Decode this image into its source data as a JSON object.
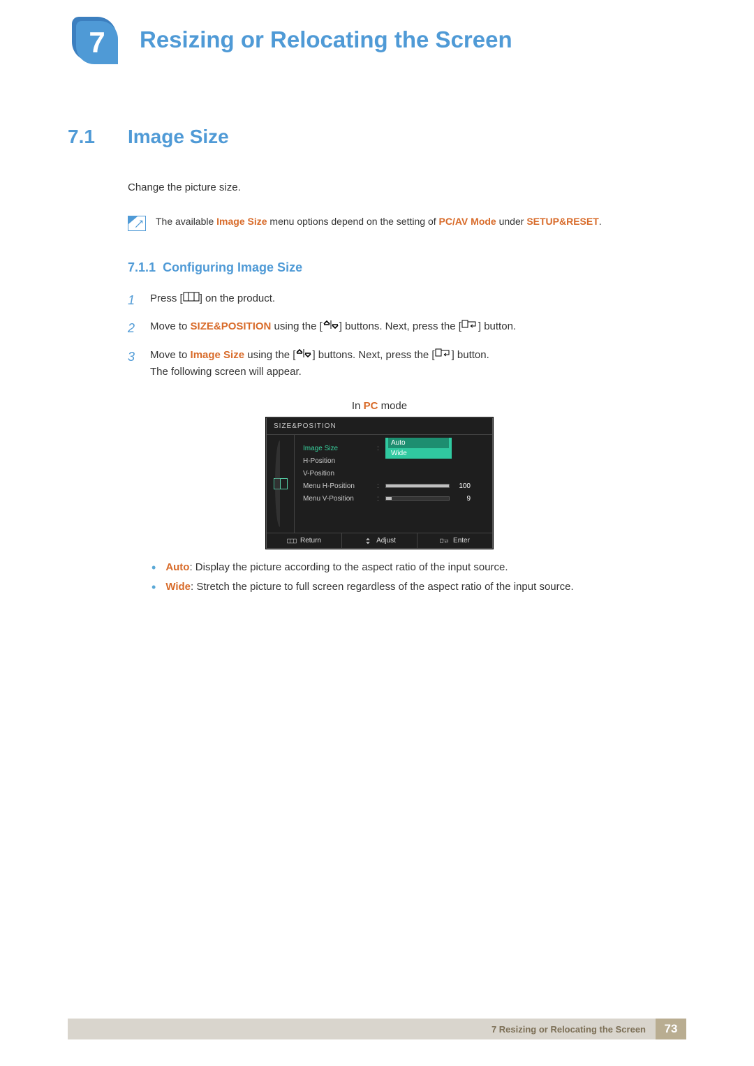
{
  "chapter": {
    "number": "7",
    "title": "Resizing or Relocating the Screen"
  },
  "section": {
    "number": "7.1",
    "title": "Image Size"
  },
  "intro": "Change the picture size.",
  "note": {
    "pre": "The available ",
    "hl1": "Image Size",
    "mid": " menu options depend on the setting of ",
    "hl2": "PC/AV Mode",
    "mid2": " under ",
    "hl3": "SETUP&RESET",
    "post": "."
  },
  "subsection": {
    "number": "7.1.1",
    "title": "Configuring Image Size"
  },
  "steps": [
    {
      "n": "1",
      "pre": "Press [",
      "post": "] on the product."
    },
    {
      "n": "2",
      "pre": "Move to ",
      "hl": "SIZE&POSITION",
      "mid1": " using the [",
      "mid2": "] buttons. Next, press the [",
      "post": "] button."
    },
    {
      "n": "3",
      "pre": "Move to ",
      "hl": "Image Size",
      "mid1": " using the [",
      "mid2": "] buttons. Next, press the [",
      "post": "] button.",
      "extra": "The following screen will appear."
    }
  ],
  "osd_caption": {
    "pre": "In ",
    "hl": "PC",
    "post": " mode"
  },
  "osd": {
    "title": "SIZE&POSITION",
    "rows": {
      "imagesize": "Image Size",
      "hpos": "H-Position",
      "vpos": "V-Position",
      "menuh": "Menu H-Position",
      "menuv": "Menu V-Position"
    },
    "dropdown": {
      "auto": "Auto",
      "wide": "Wide"
    },
    "values": {
      "menuh": "100",
      "menuv": "9"
    },
    "footer": {
      "return": "Return",
      "adjust": "Adjust",
      "enter": "Enter"
    }
  },
  "bullets": [
    {
      "hl": "Auto",
      "text": ": Display the picture according to the aspect ratio of the input source."
    },
    {
      "hl": "Wide",
      "text": ": Stretch the picture to full screen regardless of the aspect ratio of the input source."
    }
  ],
  "footer": {
    "text": "7 Resizing or Relocating the Screen",
    "page": "73"
  }
}
